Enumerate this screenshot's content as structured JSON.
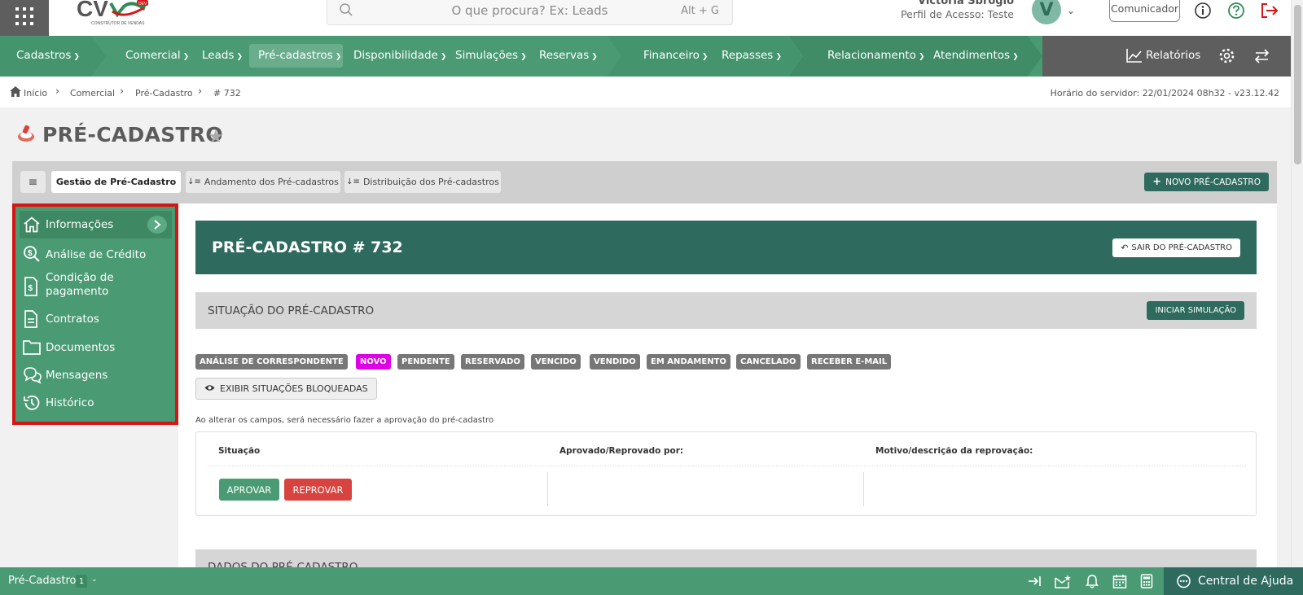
{
  "header": {
    "logo_text": "CV",
    "logo_tagline": "CONSTRUTOR DE VENDAS",
    "logo_badge": "DEV",
    "search_placeholder": "O que procura? Ex: Leads",
    "search_shortcut": "Alt + G",
    "user_name": "Victória Sbrogio",
    "user_profile": "Perfil de Acesso: Teste",
    "avatar_letter": "V",
    "comunicador_label": "Comunicador"
  },
  "nav": {
    "items": [
      {
        "label": "Cadastros"
      },
      {
        "label": "Comercial"
      },
      {
        "label": "Leads"
      },
      {
        "label": "Pré-cadastros"
      },
      {
        "label": "Disponibilidade"
      },
      {
        "label": "Simulações"
      },
      {
        "label": "Reservas"
      },
      {
        "label": "Financeiro"
      },
      {
        "label": "Repasses"
      },
      {
        "label": "Relacionamento"
      },
      {
        "label": "Atendimentos"
      }
    ],
    "reports_label": "Relatórios"
  },
  "breadcrumb": {
    "items": [
      "Início",
      "Comercial",
      "Pré-Cadastro",
      "# 732"
    ],
    "server_time": "Horário do servidor: 22/01/2024 08h32 - v23.12.42"
  },
  "page": {
    "title": "PRÉ-CADASTRO"
  },
  "tabs": {
    "items": [
      {
        "label": "Gestão de Pré-Cadastro"
      },
      {
        "label": "Andamento dos Pré-cadastros"
      },
      {
        "label": "Distribuição dos Pré-cadastros"
      }
    ],
    "new_button": "NOVO PRÉ-CADASTRO"
  },
  "left_menu": {
    "items": [
      {
        "label": "Informações"
      },
      {
        "label": "Análise de Crédito"
      },
      {
        "label": "Condição de pagamento"
      },
      {
        "label": "Contratos"
      },
      {
        "label": "Documentos"
      },
      {
        "label": "Mensagens"
      },
      {
        "label": "Histórico"
      }
    ]
  },
  "main": {
    "header_title": "PRÉ-CADASTRO # 732",
    "exit_button": "SAIR DO PRÉ-CADASTRO",
    "situation_title": "SITUAÇÃO DO PRÉ-CADASTRO",
    "start_simulation": "INICIAR SIMULAÇÃO",
    "badges": [
      "ANÁLISE DE CORRESPONDENTE",
      "NOVO",
      "PENDENTE",
      "RESERVADO",
      "VENCIDO",
      "VENDIDO",
      "EM ANDAMENTO",
      "CANCELADO",
      "RECEBER E-MAIL"
    ],
    "show_blocked": "EXIBIR SITUAÇÕES BLOQUEADAS",
    "note": "Ao alterar os campos, será necessário fazer a aprovação do pré-cadastro",
    "approval": {
      "col_situation": "Situação",
      "col_approved_by": "Aprovado/Reprovado por:",
      "col_reason": "Motivo/descrição da reprovação:",
      "approve": "APROVAR",
      "reject": "REPROVAR"
    },
    "dados_title": "DADOS DO PRÉ-CADASTRO"
  },
  "bottom": {
    "label": "Pré-Cadastro",
    "count": "1",
    "help": "Central de Ajuda"
  },
  "colors": {
    "nav_green": "#4a9b74",
    "dark_teal": "#2e6b5e",
    "novo_badge": "#e000e8",
    "reject_red": "#d9433f",
    "highlight_border": "#d61616"
  }
}
